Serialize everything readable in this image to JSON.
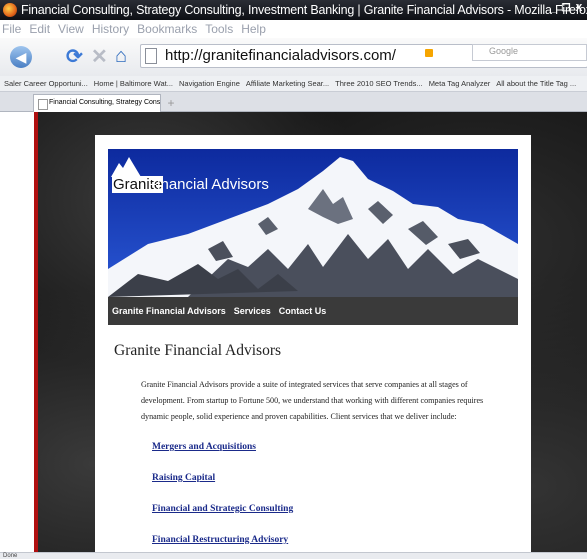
{
  "window": {
    "title": "Financial Consulting, Strategy Consulting, Investment Banking | Granite Financial Advisors - Mozilla Firefox",
    "controls": [
      "_",
      "❐",
      "X"
    ]
  },
  "menu": [
    "File",
    "Edit",
    "View",
    "History",
    "Bookmarks",
    "Tools",
    "Help"
  ],
  "toolbar": {
    "url": "http://granitefinancialadvisors.com/",
    "search_placeholder": "Google"
  },
  "bookmarks": [
    "Saler Career Opportuni...",
    "Home | Baltimore Wat...",
    "Navigation Engine",
    "Affiliate Marketing Sear...",
    "Three 2010 SEO Trends...",
    "Meta Tag Analyzer",
    "All about the Title Tag ..."
  ],
  "tab": {
    "label": "Financial Consulting, Strategy Consult...",
    "new_tab": "+"
  },
  "site": {
    "logo_word1": "Granite",
    "logo_word2": "Financial Advisors",
    "nav": [
      "Granite Financial Advisors",
      "Services",
      "Contact Us"
    ],
    "heading": "Granite Financial Advisors",
    "intro": "Granite Financial Advisors provide a suite of integrated services that serve companies at all stages of development.  From startup to Fortune 500, we understand that working with different companies requires dynamic people, solid experience and proven capabilities. Client services that we deliver include:",
    "services": [
      "Mergers and Acquisitions",
      "Raising Capital",
      "Financial and Strategic Consulting",
      "Financial Restructuring Advisory"
    ]
  },
  "status": "Done"
}
